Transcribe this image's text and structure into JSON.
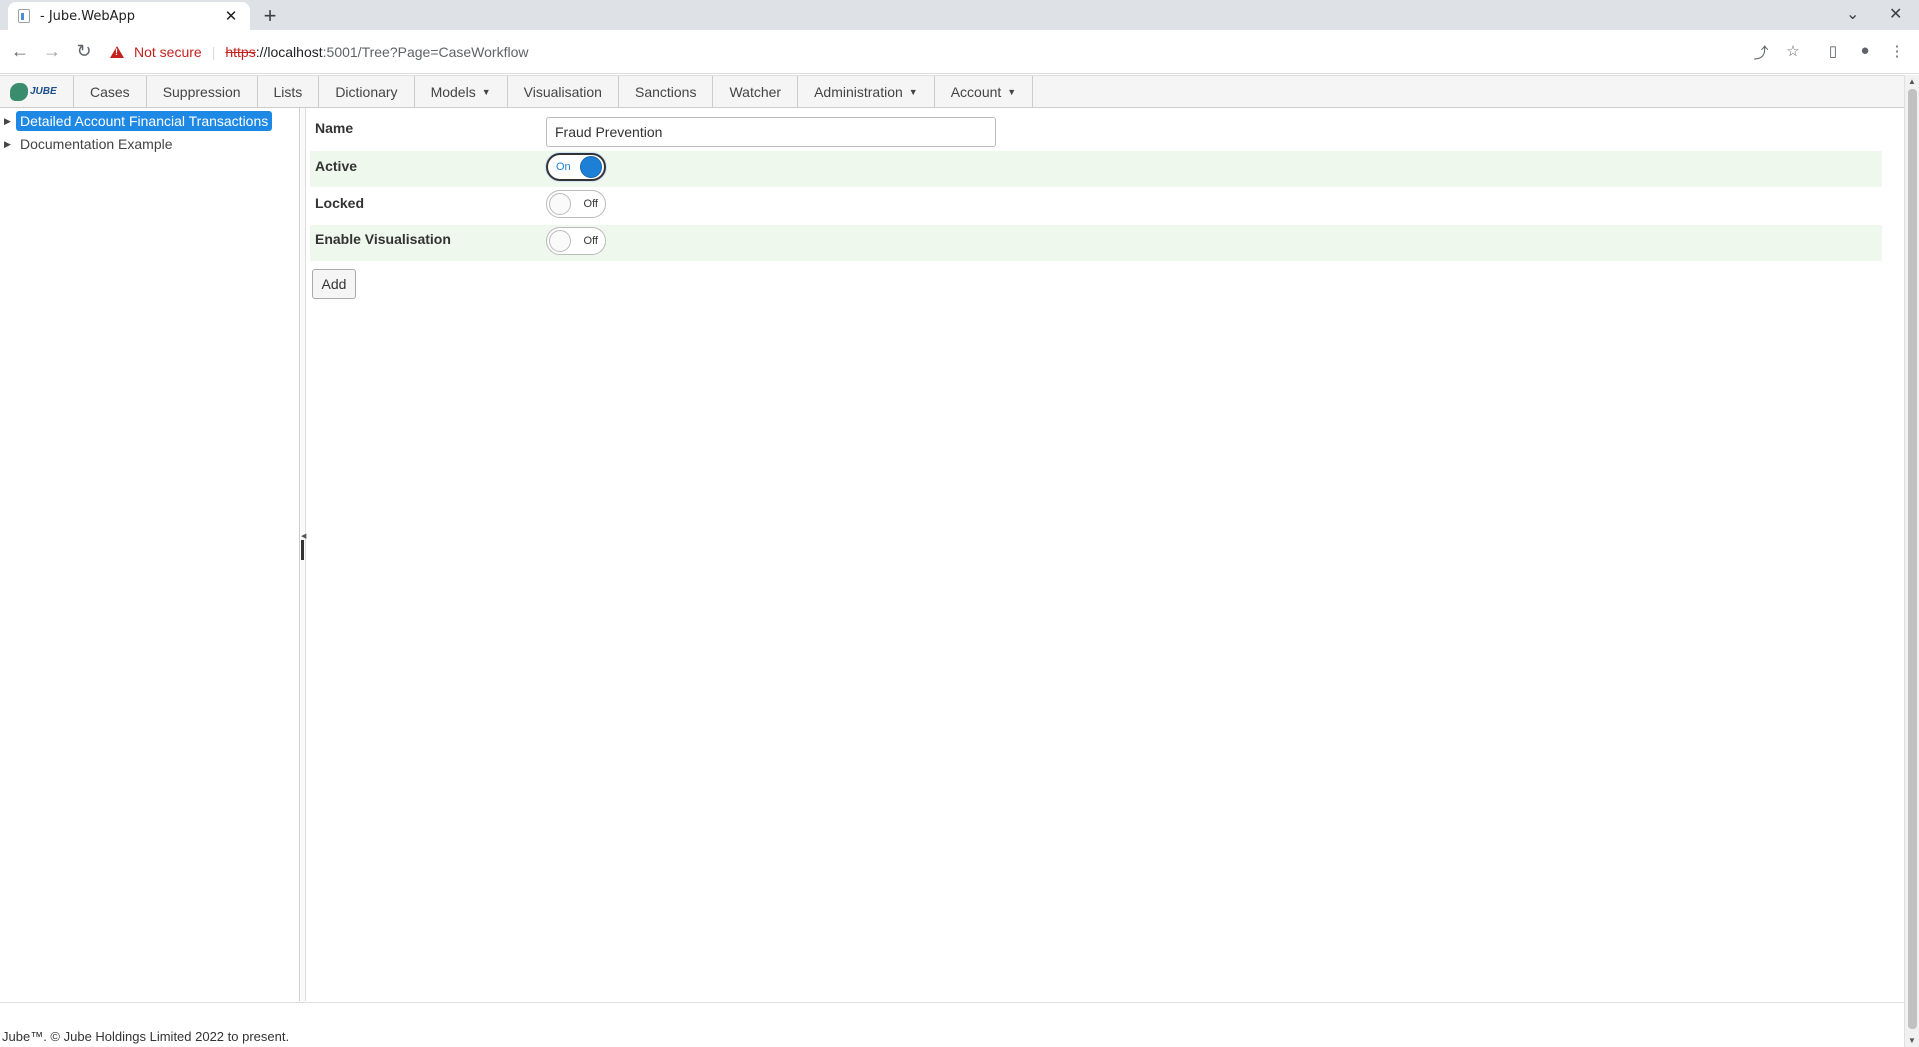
{
  "browser": {
    "tab_title": "- Jube.WebApp",
    "tab_close": "✕",
    "new_tab": "+",
    "not_secure": "Not secure",
    "url_scheme": "https",
    "url_host": "://localhost",
    "url_path": ":5001/Tree?Page=CaseWorkflow",
    "icons": [
      "back-icon",
      "forward-icon",
      "reload-icon",
      "share-icon",
      "star-icon",
      "sidepanel-icon",
      "profile-icon",
      "menu-icon"
    ]
  },
  "nav": {
    "logo_text": "JUBE",
    "items": [
      {
        "label": "Cases",
        "dropdown": false
      },
      {
        "label": "Suppression",
        "dropdown": false
      },
      {
        "label": "Lists",
        "dropdown": false
      },
      {
        "label": "Dictionary",
        "dropdown": false
      },
      {
        "label": "Models",
        "dropdown": true
      },
      {
        "label": "Visualisation",
        "dropdown": false
      },
      {
        "label": "Sanctions",
        "dropdown": false
      },
      {
        "label": "Watcher",
        "dropdown": false
      },
      {
        "label": "Administration",
        "dropdown": true
      },
      {
        "label": "Account",
        "dropdown": true
      }
    ]
  },
  "tree": {
    "nodes": [
      {
        "label": "Detailed Account Financial Transactions",
        "selected": true
      },
      {
        "label": "Documentation Example",
        "selected": false
      }
    ]
  },
  "form": {
    "name_label": "Name",
    "name_value": "Fraud Prevention",
    "active_label": "Active",
    "active_state": "On",
    "locked_label": "Locked",
    "locked_state": "Off",
    "visualisation_label": "Enable Visualisation",
    "visualisation_state": "Off",
    "add_label": "Add"
  },
  "footer": {
    "text": "Jube™. © Jube Holdings Limited 2022 to present."
  },
  "colors": {
    "accent": "#1e88e5",
    "row_alt": "#eef8ec",
    "warning": "#c5221f"
  }
}
